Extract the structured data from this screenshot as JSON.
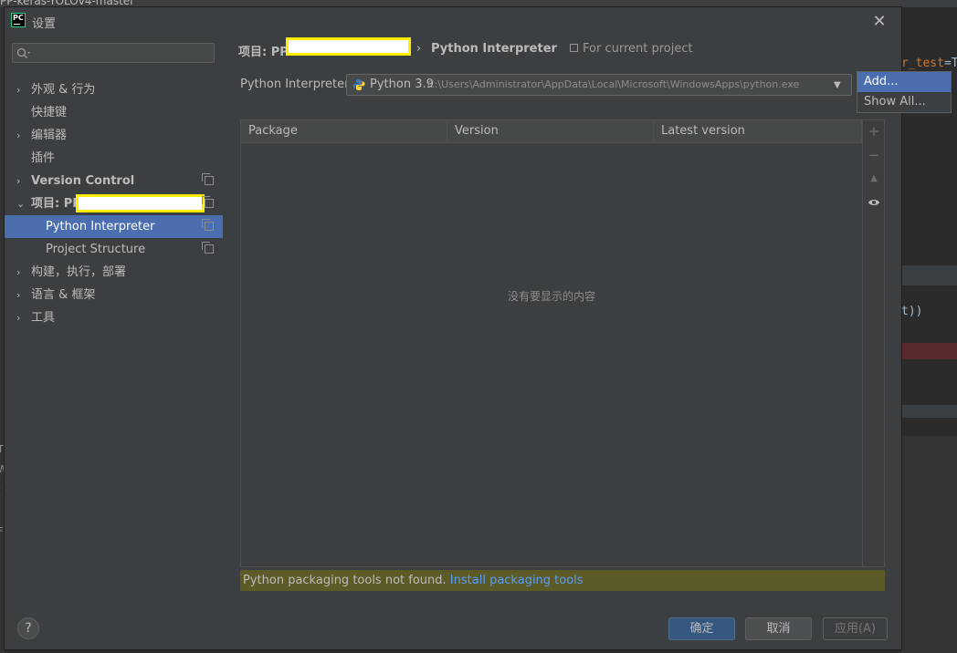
{
  "background": {
    "window_title": "PP-keras-YOLOv4-master",
    "code_fragment_1_kw": "r_test",
    "code_fragment_1_rest": "=T",
    "code_fragment_2": "t))",
    "left_glyphs": [
      "T",
      "W",
      "(",
      "F"
    ]
  },
  "dialog": {
    "title": "设置",
    "close_icon": "close-icon"
  },
  "sidebar": {
    "search_placeholder": "",
    "items": [
      {
        "label": "外观 & 行为",
        "arrow": "›"
      },
      {
        "label": "快捷键"
      },
      {
        "label": "编辑器",
        "arrow": "›"
      },
      {
        "label": "插件"
      },
      {
        "label": "Version Control",
        "arrow": "›"
      },
      {
        "label": "项目: PP",
        "arrow": "⌄"
      },
      {
        "label": "Python Interpreter"
      },
      {
        "label": "Project Structure"
      },
      {
        "label": "构建，执行，部署",
        "arrow": "›"
      },
      {
        "label": "语言 & 框架",
        "arrow": "›"
      },
      {
        "label": "工具",
        "arrow": "›"
      }
    ]
  },
  "breadcrumb": {
    "part1": "项目: PP-",
    "separator": "›",
    "part2": "Python Interpreter",
    "for_current_project": "For current project"
  },
  "interpreter": {
    "label": "Python Interpreter:",
    "version": "Python 3.9",
    "path": "C:\\Users\\Administrator\\AppData\\Local\\Microsoft\\WindowsApps\\python.exe"
  },
  "packages_table": {
    "columns": [
      "Package",
      "Version",
      "Latest version"
    ],
    "empty_text": "没有要显示的内容",
    "tools": [
      "+",
      "−",
      "▲",
      "👁"
    ]
  },
  "warning": {
    "text": "Python packaging tools not found.",
    "link": "Install packaging tools"
  },
  "popup": {
    "items": [
      "Add...",
      "Show All..."
    ]
  },
  "footer": {
    "help": "?",
    "ok": "确定",
    "cancel": "取消",
    "apply": "应用(A)"
  },
  "colors": {
    "selection": "#4b6eaf",
    "warning_bg": "#5c5a26",
    "link": "#589df6",
    "redaction_border": "#ffee00"
  }
}
